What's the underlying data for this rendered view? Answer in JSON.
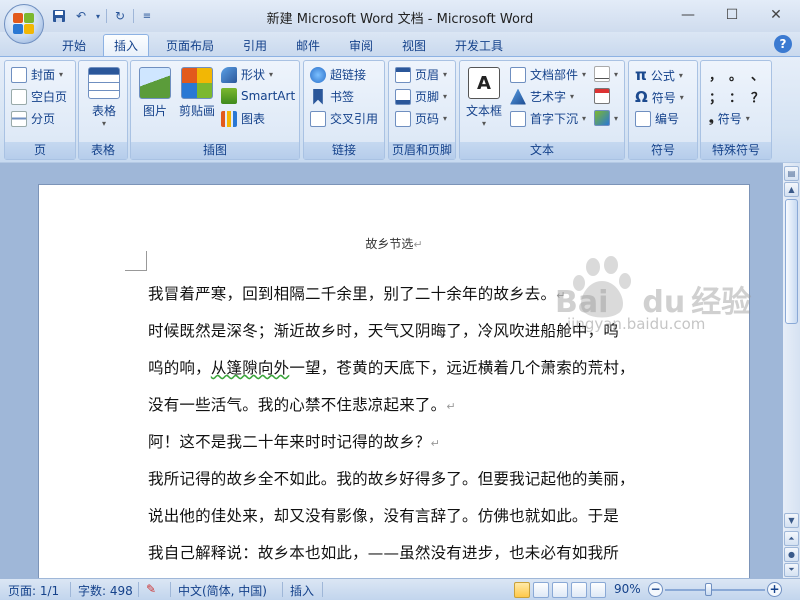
{
  "window": {
    "title": "新建 Microsoft Word 文档 - Microsoft Word"
  },
  "tabs": [
    {
      "label": "开始"
    },
    {
      "label": "插入"
    },
    {
      "label": "页面布局"
    },
    {
      "label": "引用"
    },
    {
      "label": "邮件"
    },
    {
      "label": "审阅"
    },
    {
      "label": "视图"
    },
    {
      "label": "开发工具"
    }
  ],
  "active_tab": "插入",
  "ribbon": {
    "pages": {
      "label": "页",
      "cover": "封面",
      "blank_page": "空白页",
      "page_break": "分页"
    },
    "tables": {
      "label": "表格",
      "table": "表格"
    },
    "illustrations": {
      "label": "插图",
      "picture": "图片",
      "clipart": "剪贴画",
      "shapes": "形状",
      "smartart": "SmartArt",
      "chart": "图表"
    },
    "links": {
      "label": "链接",
      "hyperlink": "超链接",
      "bookmark": "书签",
      "cross_reference": "交叉引用"
    },
    "header_footer": {
      "label": "页眉和页脚",
      "header": "页眉",
      "footer": "页脚",
      "page_number": "页码"
    },
    "text": {
      "label": "文本",
      "textbox": "文本框",
      "quick_parts": "文档部件",
      "wordart": "艺术字",
      "dropcap": "首字下沉"
    },
    "symbols": {
      "label": "符号",
      "equation": "公式",
      "symbol": "符号",
      "numbering": "编号"
    },
    "special_symbols": {
      "label": "特殊符号",
      "chars": [
        "，",
        "。",
        "、",
        "；",
        "：",
        "？"
      ],
      "symbol": "符号"
    }
  },
  "document": {
    "header": "故乡节选",
    "lines": [
      "我冒着严寒，回到相隔二千余里，别了二十余年的故乡去。",
      "时候既然是深冬；渐近故乡时，天气又阴晦了，冷风吹进船舱中，呜",
      "呜的响，从篷隙向外一望，苍黄的天底下，远近横着几个萧索的荒村，",
      "没有一些活气。我的心禁不住悲凉起来了。",
      "阿！这不是我二十年来时时记得的故乡？",
      "我所记得的故乡全不如此。我的故乡好得多了。但要我记起他的美丽，",
      "说出他的佳处来，却又没有影像，没有言辞了。仿佛也就如此。于是",
      "我自己解释说：故乡本也如此，——虽然没有进步，也未必有如我所"
    ],
    "wavy_span": "从篷隙向外"
  },
  "watermark": {
    "brand": "Bai",
    "brand2": "du",
    "cn": "经验",
    "url": "jingyan.baidu.com"
  },
  "status": {
    "page": "页面: 1/1",
    "words": "字数: 498",
    "language": "中文(简体, 中国)",
    "mode": "插入",
    "zoom": "90%"
  }
}
